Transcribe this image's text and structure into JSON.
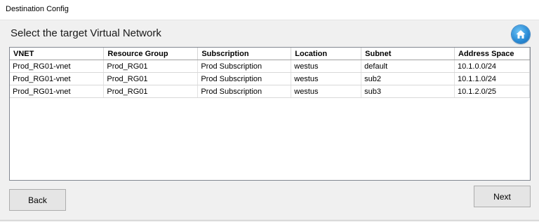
{
  "window": {
    "title": "Destination Config"
  },
  "heading": "Select the target Virtual Network",
  "home_button": {
    "icon": "home-icon"
  },
  "table": {
    "columns": [
      "VNET",
      "Resource Group",
      "Subscription",
      "Location",
      "Subnet",
      "Address Space"
    ],
    "rows": [
      [
        "Prod_RG01-vnet",
        "Prod_RG01",
        "Prod Subscription",
        "westus",
        "default",
        "10.1.0.0/24"
      ],
      [
        "Prod_RG01-vnet",
        "Prod_RG01",
        "Prod Subscription",
        "westus",
        "sub2",
        "10.1.1.0/24"
      ],
      [
        "Prod_RG01-vnet",
        "Prod_RG01",
        "Prod Subscription",
        "westus",
        "sub3",
        "10.1.2.0/25"
      ]
    ]
  },
  "buttons": {
    "back": "Back",
    "next": "Next"
  },
  "colors": {
    "home_button": "#2d8fd8",
    "grid_border": "#828790",
    "window_bg": "#f0f0f0"
  }
}
